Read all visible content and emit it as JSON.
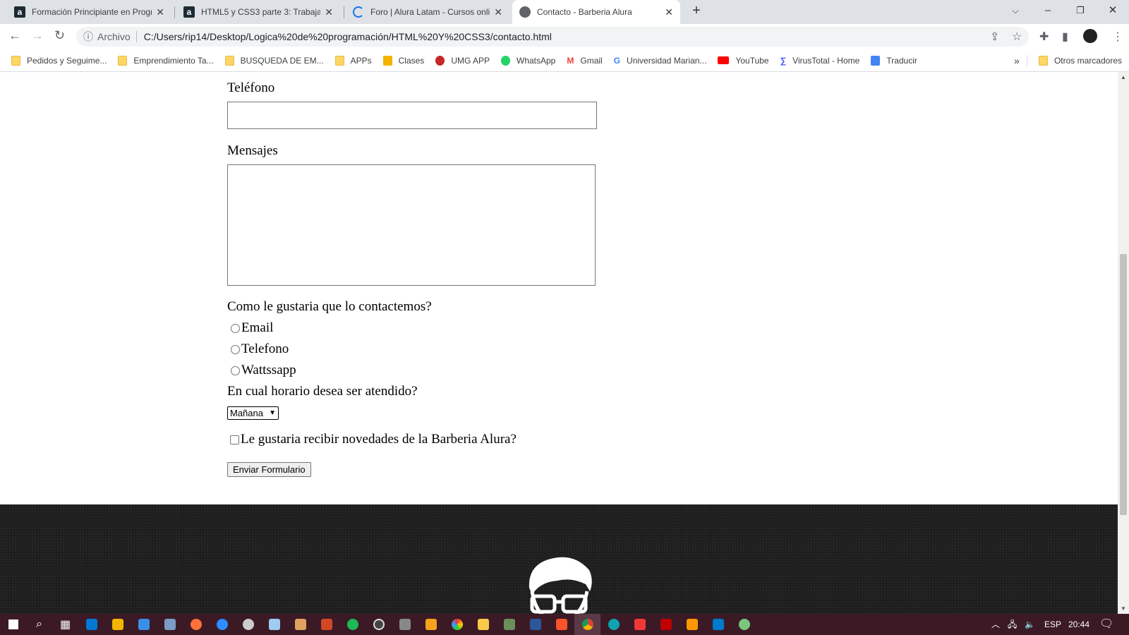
{
  "browser": {
    "tabs": [
      {
        "title": "Formación Principiante en Progra",
        "icon": "alura-icon",
        "active": false
      },
      {
        "title": "HTML5 y CSS3 parte 3: Trabajand",
        "icon": "alura-icon",
        "active": false
      },
      {
        "title": "Foro | Alura Latam - Cursos onlin",
        "icon": "loading-icon",
        "active": false
      },
      {
        "title": "Contacto - Barberia Alura",
        "icon": "globe-icon",
        "active": true
      }
    ],
    "address": {
      "security_label": "Archivo",
      "url": "C:/Users/rip14/Desktop/Logica%20de%20programación/HTML%20Y%20CSS3/contacto.html"
    },
    "bookmarks": [
      {
        "label": "Pedidos y Seguime...",
        "icon": "folder",
        "color": "#fdd663"
      },
      {
        "label": "Emprendimiento Ta...",
        "icon": "folder",
        "color": "#fdd663"
      },
      {
        "label": "BUSQUEDA DE EM...",
        "icon": "folder",
        "color": "#fdd663"
      },
      {
        "label": "APPs",
        "icon": "folder",
        "color": "#fdd663"
      },
      {
        "label": "Clases",
        "icon": "classroom-icon",
        "color": "#f4b400"
      },
      {
        "label": "UMG APP",
        "icon": "umg-icon",
        "color": "#c62828"
      },
      {
        "label": "WhatsApp",
        "icon": "whatsapp-icon",
        "color": "#25d366"
      },
      {
        "label": "Gmail",
        "icon": "gmail-icon",
        "color": "#ea4335"
      },
      {
        "label": "Universidad Marian...",
        "icon": "google-icon",
        "color": "#4285f4"
      },
      {
        "label": "YouTube",
        "icon": "youtube-icon",
        "color": "#ff0000"
      },
      {
        "label": "VirusTotal - Home",
        "icon": "virustotal-icon",
        "color": "#394eff"
      },
      {
        "label": "Traducir",
        "icon": "translate-icon",
        "color": "#4285f4"
      }
    ],
    "more_bookmarks": "»",
    "other_bookmarks": "Otros marcadores"
  },
  "form": {
    "phone_label": "Teléfono",
    "phone_value": "",
    "messages_label": "Mensajes",
    "messages_value": "",
    "contact_question": "Como le gustaria que lo contactemos?",
    "contact_options": [
      "Email",
      "Telefono",
      "Wattssapp"
    ],
    "schedule_question": "En cual horario desea ser atendido?",
    "schedule_selected": "Mañana",
    "newsletter_label": "Le gustaria recibir novedades de la Barberia Alura?",
    "newsletter_checked": false,
    "submit_label": "Enviar Formulario"
  },
  "taskbar": {
    "language": "ESP",
    "time": "20:44"
  }
}
